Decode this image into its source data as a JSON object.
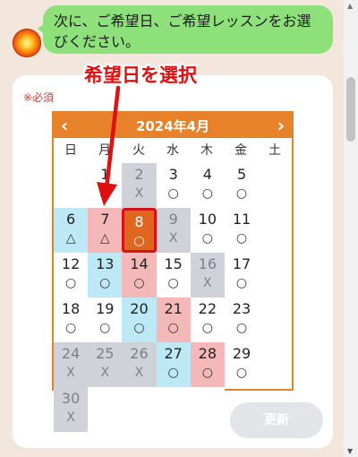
{
  "chat": {
    "message": "次に、ご希望日、ご希望レッスンをお選びください。"
  },
  "form": {
    "required_label": "※必須",
    "update_label": "更新"
  },
  "calendar": {
    "title": "2024年4月",
    "prev_icon": "chevron-left-icon",
    "next_icon": "chevron-right-icon",
    "weekdays": [
      "日",
      "月",
      "火",
      "水",
      "木",
      "金",
      "土"
    ],
    "weeks": [
      [
        {
          "day": "",
          "mark": ""
        },
        {
          "day": "1",
          "mark": "○"
        },
        {
          "day": "2",
          "mark": "X"
        },
        {
          "day": "3",
          "mark": "○"
        },
        {
          "day": "4",
          "mark": "○"
        },
        {
          "day": "5",
          "mark": "○"
        },
        {
          "day": "6",
          "mark": "△"
        }
      ],
      [
        {
          "day": "7",
          "mark": "△"
        },
        {
          "day": "8",
          "mark": "○"
        },
        {
          "day": "9",
          "mark": "X"
        },
        {
          "day": "10",
          "mark": "○"
        },
        {
          "day": "11",
          "mark": "○"
        },
        {
          "day": "12",
          "mark": "○"
        },
        {
          "day": "13",
          "mark": "○"
        }
      ],
      [
        {
          "day": "14",
          "mark": "○"
        },
        {
          "day": "15",
          "mark": "○"
        },
        {
          "day": "16",
          "mark": "X"
        },
        {
          "day": "17",
          "mark": "○"
        },
        {
          "day": "18",
          "mark": "○"
        },
        {
          "day": "19",
          "mark": "○"
        },
        {
          "day": "20",
          "mark": "○"
        }
      ],
      [
        {
          "day": "21",
          "mark": "○"
        },
        {
          "day": "22",
          "mark": "○"
        },
        {
          "day": "23",
          "mark": "○"
        },
        {
          "day": "24",
          "mark": "X"
        },
        {
          "day": "25",
          "mark": "X"
        },
        {
          "day": "26",
          "mark": "X"
        },
        {
          "day": "27",
          "mark": "○"
        }
      ],
      [
        {
          "day": "28",
          "mark": "○"
        },
        {
          "day": "29",
          "mark": "○"
        },
        {
          "day": "30",
          "mark": "X"
        },
        {
          "day": "",
          "mark": ""
        },
        {
          "day": "",
          "mark": ""
        },
        {
          "day": "",
          "mark": ""
        },
        {
          "day": "",
          "mark": ""
        }
      ]
    ],
    "selected_day": "8"
  },
  "annotation": {
    "label": "希望日を選択"
  },
  "colors": {
    "accent": "#e8822a",
    "selected": "#e0661f",
    "annotation": "#e01010",
    "bubble": "#8de07a"
  }
}
